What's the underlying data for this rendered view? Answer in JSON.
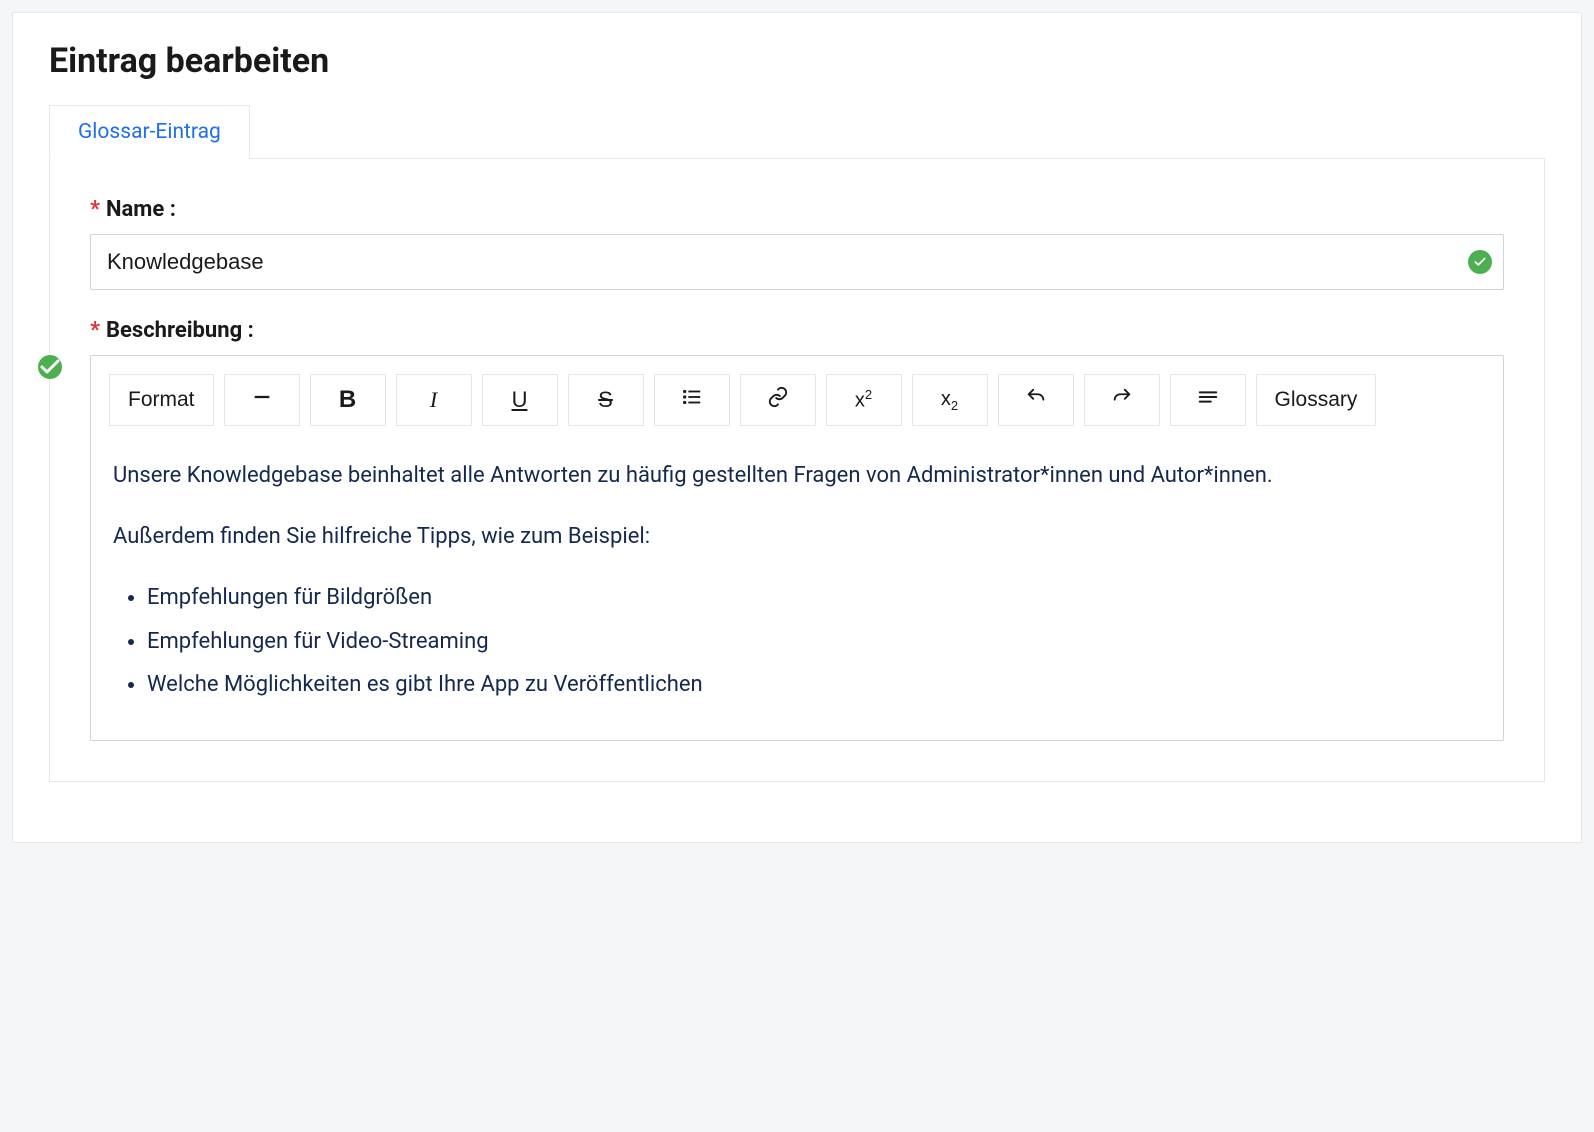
{
  "page": {
    "title": "Eintrag bearbeiten"
  },
  "tabs": {
    "active": "Glossar-Eintrag"
  },
  "fields": {
    "name": {
      "label": "Name :",
      "required": "*",
      "value": "Knowledgebase"
    },
    "description": {
      "label": "Beschreibung :",
      "required": "*"
    }
  },
  "toolbar": {
    "format": "Format",
    "glossary": "Glossary",
    "bold": "B",
    "italic": "I",
    "underline": "U",
    "strike": "S",
    "sup": "x",
    "sup_exp": "2",
    "sub": "x",
    "sub_exp": "2"
  },
  "content": {
    "p1": "Unsere Knowledgebase beinhaltet alle Antworten zu häufig gestellten Fragen von Administrator*innen und Autor*innen.",
    "p2": "Außerdem finden Sie hilfreiche Tipps, wie zum Beispiel:",
    "bullets": [
      "Empfehlungen für Bildgrößen",
      "Empfehlungen für Video-Streaming",
      "Welche Möglichkeiten es gibt Ihre App zu Veröffentlichen"
    ]
  }
}
